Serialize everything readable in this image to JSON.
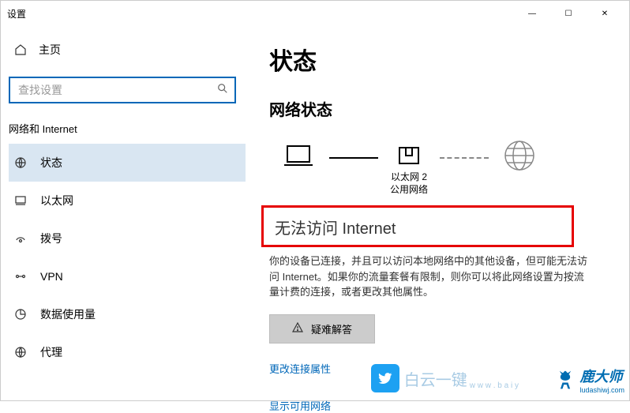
{
  "window": {
    "title": "设置",
    "minimize": "—",
    "maximize": "☐",
    "close": "✕"
  },
  "sidebar": {
    "home_label": "主页",
    "search_placeholder": "查找设置",
    "section_title": "网络和 Internet",
    "items": [
      {
        "label": "状态"
      },
      {
        "label": "以太网"
      },
      {
        "label": "拨号"
      },
      {
        "label": "VPN"
      },
      {
        "label": "数据使用量"
      },
      {
        "label": "代理"
      }
    ]
  },
  "content": {
    "title": "状态",
    "subtitle": "网络状态",
    "diagram": {
      "ethernet_name": "以太网 2",
      "network_type": "公用网络"
    },
    "status_headline": "无法访问 Internet",
    "description": "你的设备已连接，并且可以访问本地网络中的其他设备，但可能无法访问 Internet。如果你的流量套餐有限制，则你可以将此网络设置为按流量计费的连接，或者更改其他属性。",
    "troubleshoot_label": "疑难解答",
    "link_change": "更改连接属性",
    "link_show": "显示可用网络"
  },
  "watermarks": {
    "wm1_text": "白云一键",
    "wm1_sub": "w w w . b a i y",
    "wm2_text": "鹿大师",
    "wm2_sub": "ludashiwj.com"
  }
}
